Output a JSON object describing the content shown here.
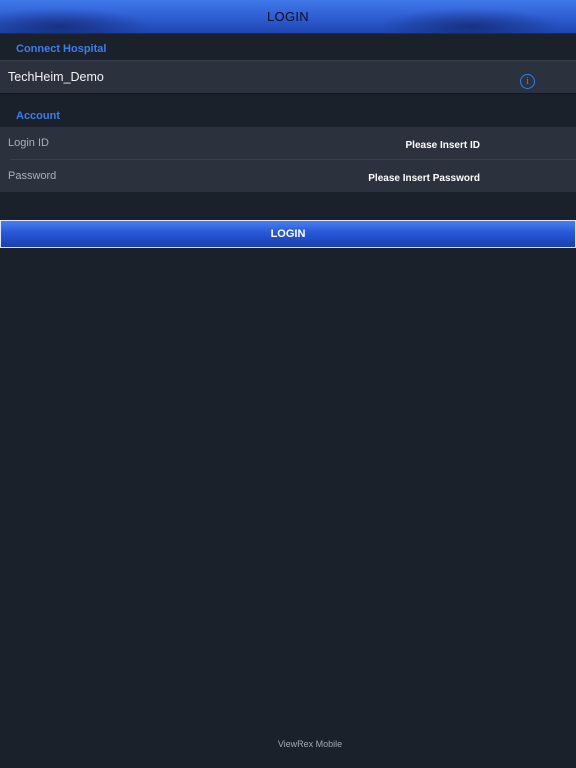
{
  "nav": {
    "title": "LOGIN"
  },
  "connect_section": {
    "header": "Connect Hospital",
    "hospital_name": "TechHeim_Demo",
    "info_icon": "info-icon",
    "info_glyph": "i"
  },
  "account_section": {
    "header": "Account",
    "login_id": {
      "label": "Login ID",
      "value": "",
      "placeholder": "Please Insert ID"
    },
    "password": {
      "label": "Password",
      "value": "",
      "placeholder": "Please Insert Password"
    }
  },
  "login_button": {
    "label": "LOGIN"
  },
  "footer": {
    "text": "ViewRex Mobile"
  },
  "colors": {
    "background": "#1b212b",
    "accent": "#2f7ff0",
    "button_blue": "#2857d6",
    "row_background": "#2b323d"
  }
}
